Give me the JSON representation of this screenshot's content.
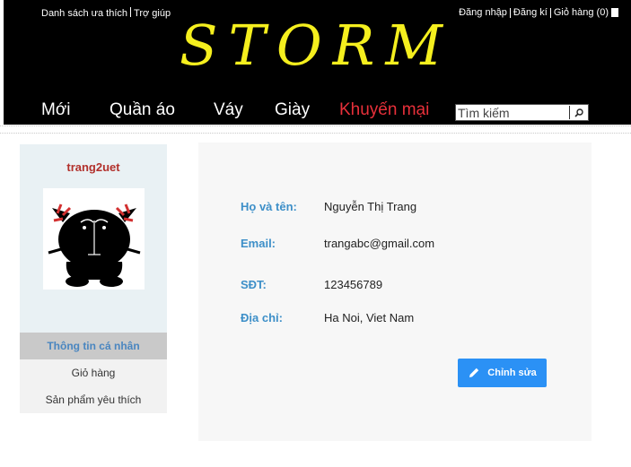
{
  "topbar": {
    "favorites": "Danh sách ưa thích",
    "help": "Trợ giúp",
    "login": "Đăng nhập",
    "register": "Đăng kí",
    "cart": "Giỏ hàng (0)"
  },
  "logo": "STORM",
  "nav": {
    "items": [
      "Mới",
      "Quần áo",
      "Váy",
      "Giày",
      "Khuyến mại"
    ],
    "promo_color": "#e8303a"
  },
  "search": {
    "placeholder": "Tìm kiếm",
    "icon": "search-icon"
  },
  "sidebar": {
    "username": "trang2uet",
    "menu": [
      "Thông tin cá nhân",
      "Giỏ hàng",
      "Sản phẩm yêu thích"
    ],
    "active_index": 0
  },
  "profile": {
    "name_label": "Họ và tên:",
    "name_value": "Nguyễn Thị Trang",
    "email_label": "Email:",
    "email_value": "trangabc@gmail.com",
    "phone_label": "SĐT:",
    "phone_value": "123456789",
    "address_label": "Địa chỉ:",
    "address_value": "Ha Noi, Viet Nam"
  },
  "edit_button": {
    "label": "Chỉnh sửa",
    "icon": "pencil-icon"
  },
  "colors": {
    "logo": "#f5ef1e",
    "header_bg": "#000000",
    "username": "#b2312c",
    "label": "#3d8fc8",
    "button": "#2b91f5"
  }
}
